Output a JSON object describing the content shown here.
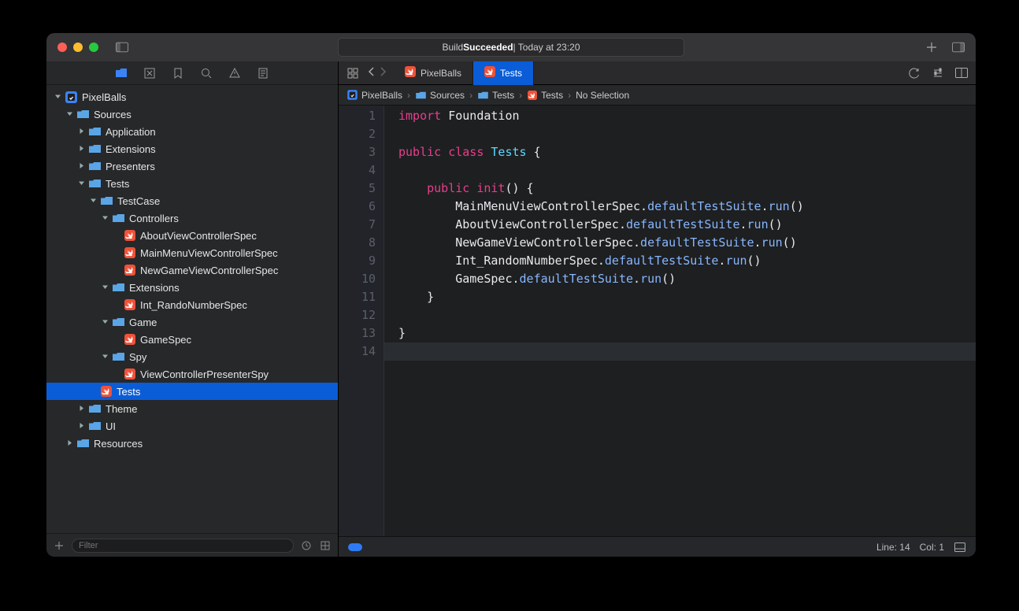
{
  "status": {
    "prefix": "Build ",
    "emphasis": "Succeeded",
    "suffix": " | Today at 23:20"
  },
  "tabs": [
    {
      "label": "PixelBalls",
      "active": false
    },
    {
      "label": "Tests",
      "active": true
    }
  ],
  "jumpbar": [
    {
      "icon": "app",
      "label": "PixelBalls"
    },
    {
      "icon": "folder",
      "label": "Sources"
    },
    {
      "icon": "folder",
      "label": "Tests"
    },
    {
      "icon": "swift",
      "label": "Tests"
    },
    {
      "icon": "",
      "label": "No Selection"
    }
  ],
  "filter": {
    "placeholder": "Filter"
  },
  "statusbar": {
    "line": "Line: 14",
    "col": "Col: 1"
  },
  "tree": [
    {
      "d": 0,
      "exp": "open",
      "i": "app",
      "t": "PixelBalls"
    },
    {
      "d": 1,
      "exp": "open",
      "i": "folder",
      "t": "Sources"
    },
    {
      "d": 2,
      "exp": "closed",
      "i": "folder",
      "t": "Application"
    },
    {
      "d": 2,
      "exp": "closed",
      "i": "folder",
      "t": "Extensions"
    },
    {
      "d": 2,
      "exp": "closed",
      "i": "folder",
      "t": "Presenters"
    },
    {
      "d": 2,
      "exp": "open",
      "i": "folder",
      "t": "Tests"
    },
    {
      "d": 3,
      "exp": "open",
      "i": "folder",
      "t": "TestCase"
    },
    {
      "d": 4,
      "exp": "open",
      "i": "folder",
      "t": "Controllers"
    },
    {
      "d": 5,
      "exp": "",
      "i": "swift",
      "t": "AboutViewControllerSpec"
    },
    {
      "d": 5,
      "exp": "",
      "i": "swift",
      "t": "MainMenuViewControllerSpec"
    },
    {
      "d": 5,
      "exp": "",
      "i": "swift",
      "t": "NewGameViewControllerSpec"
    },
    {
      "d": 4,
      "exp": "open",
      "i": "folder",
      "t": "Extensions"
    },
    {
      "d": 5,
      "exp": "",
      "i": "swift",
      "t": "Int_RandoNumberSpec"
    },
    {
      "d": 4,
      "exp": "open",
      "i": "folder",
      "t": "Game"
    },
    {
      "d": 5,
      "exp": "",
      "i": "swift",
      "t": "GameSpec"
    },
    {
      "d": 4,
      "exp": "open",
      "i": "folder",
      "t": "Spy"
    },
    {
      "d": 5,
      "exp": "",
      "i": "swift",
      "t": "ViewControllerPresenterSpy"
    },
    {
      "d": 3,
      "exp": "",
      "i": "swift",
      "t": "Tests",
      "selected": true
    },
    {
      "d": 2,
      "exp": "closed",
      "i": "folder",
      "t": "Theme"
    },
    {
      "d": 2,
      "exp": "closed",
      "i": "folder",
      "t": "UI"
    },
    {
      "d": 1,
      "exp": "closed",
      "i": "folder",
      "t": "Resources"
    }
  ],
  "code": {
    "lines": [
      [
        {
          "c": "kw",
          "t": "import"
        },
        {
          "c": "plain",
          "t": " "
        },
        {
          "c": "plain",
          "t": "Foundation"
        }
      ],
      [],
      [
        {
          "c": "kw",
          "t": "public"
        },
        {
          "c": "plain",
          "t": " "
        },
        {
          "c": "kw",
          "t": "class"
        },
        {
          "c": "plain",
          "t": " "
        },
        {
          "c": "type2",
          "t": "Tests"
        },
        {
          "c": "plain",
          "t": " {"
        }
      ],
      [],
      [
        {
          "c": "plain",
          "t": "    "
        },
        {
          "c": "kw",
          "t": "public"
        },
        {
          "c": "plain",
          "t": " "
        },
        {
          "c": "kw",
          "t": "init"
        },
        {
          "c": "plain",
          "t": "() {"
        }
      ],
      [
        {
          "c": "plain",
          "t": "        MainMenuViewControllerSpec."
        },
        {
          "c": "member",
          "t": "defaultTestSuite"
        },
        {
          "c": "plain",
          "t": "."
        },
        {
          "c": "member",
          "t": "run"
        },
        {
          "c": "plain",
          "t": "()"
        }
      ],
      [
        {
          "c": "plain",
          "t": "        AboutViewControllerSpec."
        },
        {
          "c": "member",
          "t": "defaultTestSuite"
        },
        {
          "c": "plain",
          "t": "."
        },
        {
          "c": "member",
          "t": "run"
        },
        {
          "c": "plain",
          "t": "()"
        }
      ],
      [
        {
          "c": "plain",
          "t": "        NewGameViewControllerSpec."
        },
        {
          "c": "member",
          "t": "defaultTestSuite"
        },
        {
          "c": "plain",
          "t": "."
        },
        {
          "c": "member",
          "t": "run"
        },
        {
          "c": "plain",
          "t": "()"
        }
      ],
      [
        {
          "c": "plain",
          "t": "        Int_RandomNumberSpec."
        },
        {
          "c": "member",
          "t": "defaultTestSuite"
        },
        {
          "c": "plain",
          "t": "."
        },
        {
          "c": "member",
          "t": "run"
        },
        {
          "c": "plain",
          "t": "()"
        }
      ],
      [
        {
          "c": "plain",
          "t": "        GameSpec."
        },
        {
          "c": "member",
          "t": "defaultTestSuite"
        },
        {
          "c": "plain",
          "t": "."
        },
        {
          "c": "member",
          "t": "run"
        },
        {
          "c": "plain",
          "t": "()"
        }
      ],
      [
        {
          "c": "plain",
          "t": "    }"
        }
      ],
      [],
      [
        {
          "c": "plain",
          "t": "}"
        }
      ],
      []
    ],
    "current_line": 14
  }
}
